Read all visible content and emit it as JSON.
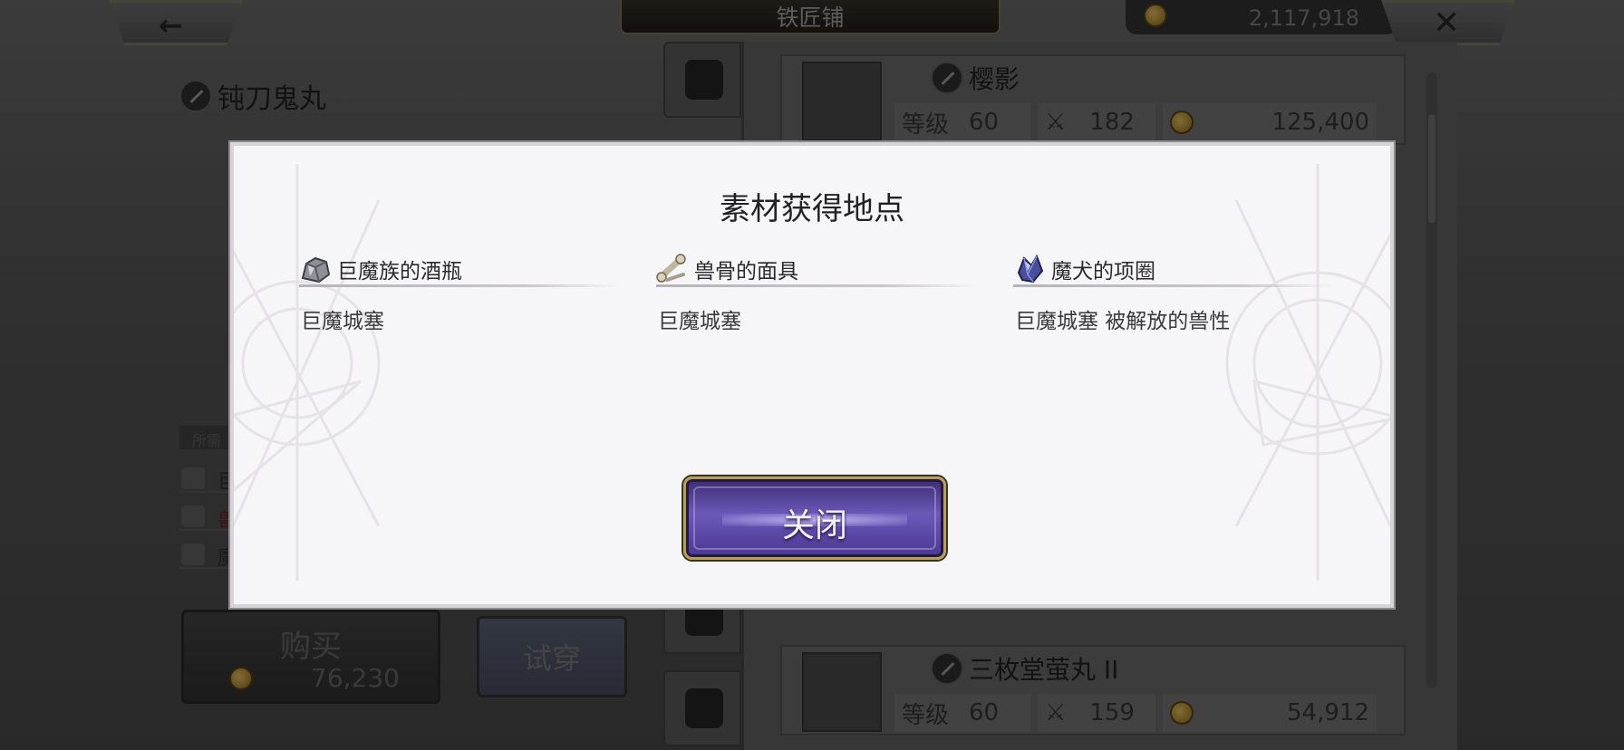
{
  "header": {
    "title": "铁匠铺",
    "gold": "2,117,918"
  },
  "item": {
    "name": "钝刀鬼丸",
    "required_label": "所需",
    "requirements_partial": [
      "巨",
      "兽",
      "魔"
    ],
    "buy_label": "购买",
    "buy_price": "76,230",
    "try_label": "试穿"
  },
  "list": {
    "items": [
      {
        "name": "樱影",
        "level_label": "等级",
        "level": "60",
        "attack": "182",
        "price": "125,400"
      },
      {
        "name": "三枚堂萤丸 II",
        "level_label": "等级",
        "level": "60",
        "attack": "159",
        "price": "54,912"
      }
    ]
  },
  "modal": {
    "title": "素材获得地点",
    "materials": [
      {
        "name": "巨魔族的酒瓶",
        "location": "巨魔城塞",
        "icon": "ore-icon"
      },
      {
        "name": "兽骨的面具",
        "location": "巨魔城塞",
        "icon": "bone-icon"
      },
      {
        "name": "魔犬的项圈",
        "location": "巨魔城塞 被解放的兽性",
        "icon": "crystal-icon"
      }
    ],
    "close_label": "关闭"
  }
}
